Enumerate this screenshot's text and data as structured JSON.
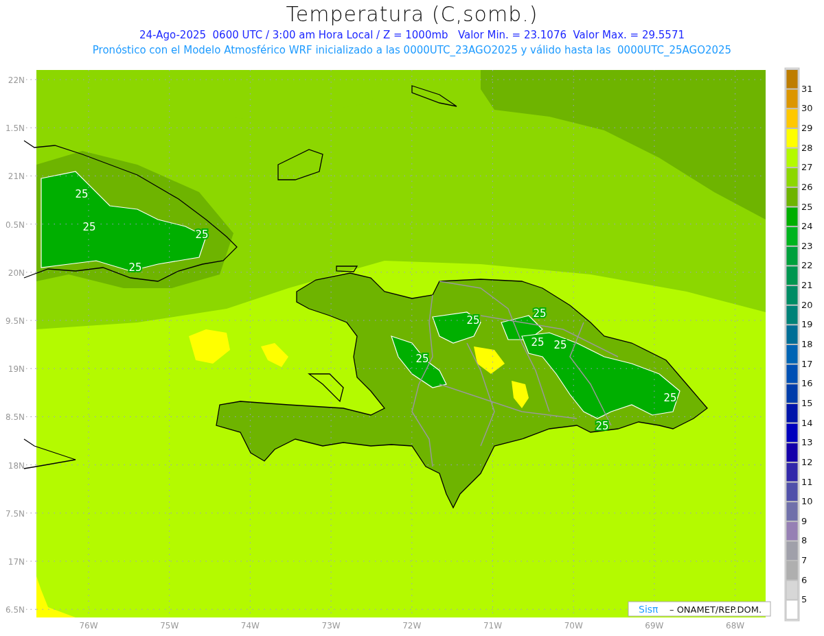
{
  "title": "Temperatura (C,somb.)",
  "subtitle": "24-Ago-2025  0600 UTC / 3:00 am Hora Local / Z = 1000mb   Valor Min. = 23.1076  Valor Max. = 29.5571",
  "forecast_note": "Pronóstico con el Modelo Atmosférico WRF inicializado a las 0000UTC_23AGO2025 y válido hasta las  0000UTC_25AGO2025",
  "lat_ticks": [
    "22N",
    "1.5N",
    "21N",
    "0.5N",
    "20N",
    "9.5N",
    "19N",
    "8.5N",
    "18N",
    "7.5N",
    "17N",
    "6.5N"
  ],
  "lon_ticks": [
    "76W",
    "75W",
    "74W",
    "73W",
    "72W",
    "71W",
    "70W",
    "69W",
    "68W"
  ],
  "contour_labels": [
    "25",
    "25",
    "25",
    "25",
    "25",
    "25",
    "25",
    "25",
    "25",
    "25",
    "25"
  ],
  "legend": [
    {
      "color": "#be7d00",
      "label": "31"
    },
    {
      "color": "#dc9600",
      "label": "30"
    },
    {
      "color": "#ffc800",
      "label": "29"
    },
    {
      "color": "#ffff00",
      "label": "28"
    },
    {
      "color": "#b4fa00",
      "label": "27"
    },
    {
      "color": "#8cd700",
      "label": "26"
    },
    {
      "color": "#6eb400",
      "label": "25"
    },
    {
      "color": "#00af00",
      "label": "24"
    },
    {
      "color": "#00b41e",
      "label": "23"
    },
    {
      "color": "#00a03c",
      "label": "22"
    },
    {
      "color": "#009650",
      "label": "21"
    },
    {
      "color": "#008c64",
      "label": "20"
    },
    {
      "color": "#008278",
      "label": "19"
    },
    {
      "color": "#006e96",
      "label": "18"
    },
    {
      "color": "#0064b4",
      "label": "17"
    },
    {
      "color": "#0050b4",
      "label": "16"
    },
    {
      "color": "#003caa",
      "label": "15"
    },
    {
      "color": "#0014aa",
      "label": "14"
    },
    {
      "color": "#0000be",
      "label": "13"
    },
    {
      "color": "#1400aa",
      "label": "12"
    },
    {
      "color": "#3228aa",
      "label": "11"
    },
    {
      "color": "#5050aa",
      "label": "10"
    },
    {
      "color": "#7070aa",
      "label": "9"
    },
    {
      "color": "#9680b4",
      "label": "8"
    },
    {
      "color": "#a0a0aa",
      "label": "7"
    },
    {
      "color": "#afafaf",
      "label": "6"
    },
    {
      "color": "#d7d7d7",
      "label": "5"
    },
    {
      "color": "#ffffff"
    }
  ],
  "credit": {
    "logo": "Sisπ",
    "text": "– ONAMET/REP.DOM."
  }
}
